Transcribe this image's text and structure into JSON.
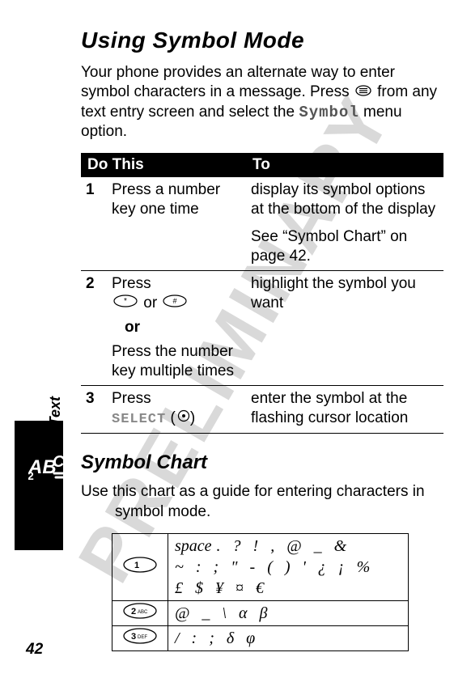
{
  "watermark": "PRELIMINARY",
  "side_label": "Entering Text",
  "title": "Using Symbol Mode",
  "intro_part1": "Your phone provides an alternate way to enter symbol characters in a message. Press",
  "intro_part2": "from any text entry screen and select the",
  "intro_menu_word": "Symbol",
  "intro_part3": "menu option.",
  "table_headers": {
    "do_this": "Do This",
    "to": "To"
  },
  "steps": [
    {
      "num": "1",
      "do": "Press a number key one time",
      "to_a": "display its symbol options at the bottom of the display",
      "to_b": "See “Symbol Chart” on page 42."
    },
    {
      "num": "2",
      "do_press": "Press",
      "do_or_word": "or",
      "do_alt": "Press the number key multiple times",
      "to": "highlight the symbol you want"
    },
    {
      "num": "3",
      "do_press": "Press",
      "do_select": "SELECT",
      "to": "enter the symbol at the flashing cursor location"
    }
  ],
  "chart_title": "Symbol Chart",
  "chart_intro": "Use this chart as a guide for entering characters in symbol mode.",
  "symrows": [
    {
      "key_label": "1",
      "line1_space_word": "space",
      "line1_rest": ". ? ! , @ _ &",
      "line2": "~ : ; \" - ( ) ' ¿ ¡ %",
      "line3": "£ $ ¥ ¤ €"
    },
    {
      "key_label": "2",
      "line1": "@ _ \\ α β"
    },
    {
      "key_label": "3",
      "line1": "/ : ; δ φ"
    }
  ],
  "page_number": "42"
}
